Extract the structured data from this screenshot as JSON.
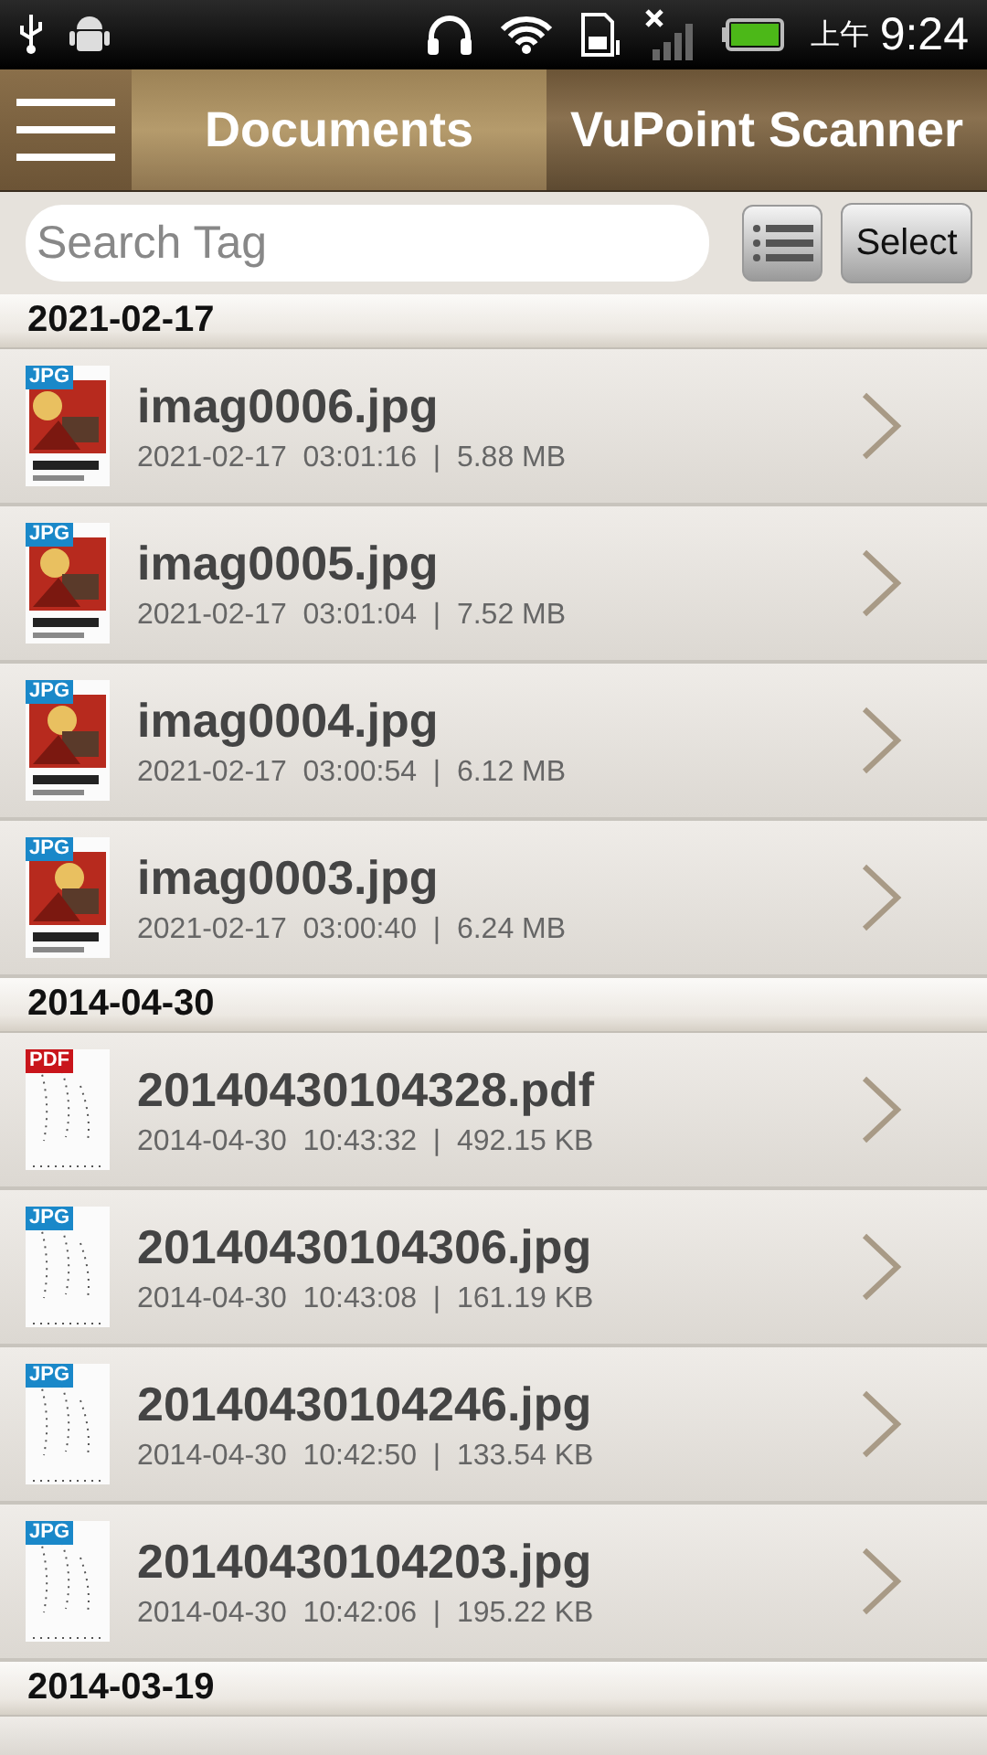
{
  "status_bar": {
    "time_prefix": "上午",
    "time": "9:24"
  },
  "header": {
    "tab": "Documents",
    "title": "VuPoint Scanner"
  },
  "toolbar": {
    "search": {
      "placeholder": "Search Tag"
    },
    "select_button": "Select"
  },
  "sections": [
    {
      "date": "2021-02-17",
      "files": [
        {
          "kind": "jpg",
          "badge": "JPG",
          "name": "imag0006.jpg",
          "details": "2021-02-17  03:01:16  |  5.88 MB"
        },
        {
          "kind": "jpg",
          "badge": "JPG",
          "name": "imag0005.jpg",
          "details": "2021-02-17  03:01:04  |  7.52 MB"
        },
        {
          "kind": "jpg",
          "badge": "JPG",
          "name": "imag0004.jpg",
          "details": "2021-02-17  03:00:54  |  6.12 MB"
        },
        {
          "kind": "jpg",
          "badge": "JPG",
          "name": "imag0003.jpg",
          "details": "2021-02-17  03:00:40  |  6.24 MB"
        }
      ]
    },
    {
      "date": "2014-04-30",
      "files": [
        {
          "kind": "pdf",
          "badge": "PDF",
          "name": "20140430104328.pdf",
          "details": "2014-04-30  10:43:32  |  492.15 KB"
        },
        {
          "kind": "jpg",
          "badge": "JPG",
          "name": "20140430104306.jpg",
          "details": "2014-04-30  10:43:08  |  161.19 KB"
        },
        {
          "kind": "jpg",
          "badge": "JPG",
          "name": "20140430104246.jpg",
          "details": "2014-04-30  10:42:50  |  133.54 KB"
        },
        {
          "kind": "jpg",
          "badge": "JPG",
          "name": "20140430104203.jpg",
          "details": "2014-04-30  10:42:06  |  195.22 KB"
        }
      ]
    },
    {
      "date": "2014-03-19"
    }
  ]
}
